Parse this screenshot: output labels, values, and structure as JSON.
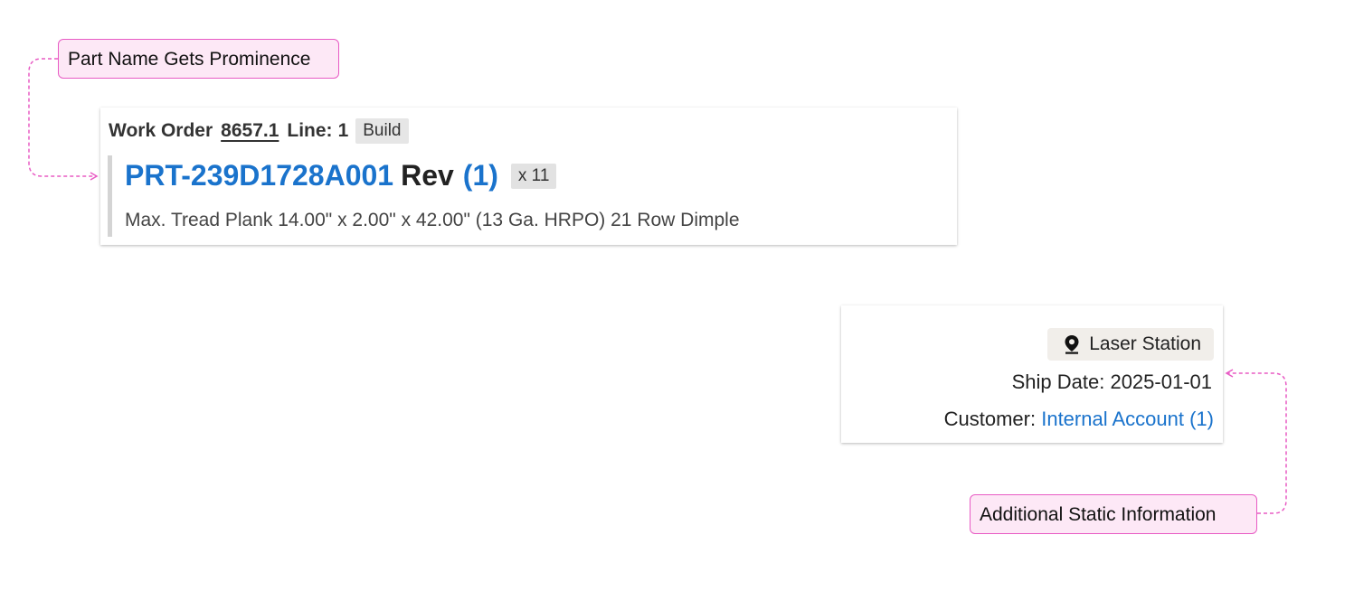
{
  "callouts": {
    "part_name": "Part Name Gets Prominence",
    "static_info": "Additional Static Information"
  },
  "work_order_card": {
    "work_order_label": "Work Order",
    "work_order_number": "8657.1",
    "line_label": "Line:",
    "line_value": "1",
    "type_tag": "Build",
    "part_number": "PRT-239D1728A001",
    "rev_label": "Rev",
    "rev_value": "(1)",
    "quantity": "x 11",
    "description": "Max. Tread Plank 14.00\" x 2.00\" x 42.00\" (13 Ga. HRPO) 21 Row Dimple"
  },
  "info_card": {
    "location": "Laser Station",
    "location_icon": "map-pin-icon",
    "ship_date_label": "Ship Date:",
    "ship_date": "2025-01-01",
    "customer_label": "Customer:",
    "customer_value": "Internal Account (1)"
  },
  "colors": {
    "accent_blue": "#1a73cc",
    "callout_border": "#e85bc4",
    "callout_fill": "#fde8f6"
  }
}
